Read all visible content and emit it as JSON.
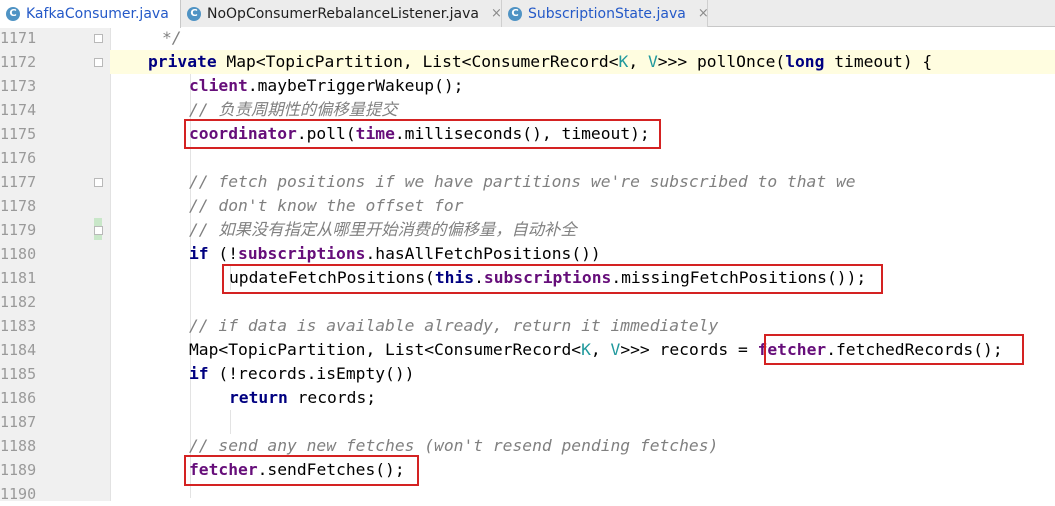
{
  "tabs": [
    {
      "label": "KafkaConsumer.java",
      "active": true
    },
    {
      "label": "NoOpConsumerRebalanceListener.java",
      "active": false
    },
    {
      "label": "SubscriptionState.java",
      "active": false
    }
  ],
  "tab_close_glyph": "×",
  "file_icon_letter": "C",
  "line_numbers": [
    "1171",
    "1172",
    "1173",
    "1174",
    "1175",
    "1176",
    "1177",
    "1178",
    "1179",
    "1180",
    "1181",
    "1182",
    "1183",
    "1184",
    "1185",
    "1186",
    "1187",
    "1188",
    "1189",
    "1190"
  ],
  "code": {
    "l1171": "*/",
    "l1172": {
      "kw_private": "private",
      "p1": " Map<TopicPartition, List<ConsumerRecord<",
      "k": "K",
      "p2": ", ",
      "v": "V",
      "p3": ">>> pollOnce(",
      "kw_long": "long",
      "p4": " timeout) {"
    },
    "l1173": {
      "fld": "client",
      "rest": ".maybeTriggerWakeup();"
    },
    "l1174": "// 负责周期性的偏移量提交",
    "l1175": {
      "fld1": "coordinator",
      "p1": ".poll(",
      "fld2": "time",
      "p2": ".milliseconds(), timeout);"
    },
    "l1177": "// fetch positions if we have partitions we're subscribed to that we",
    "l1178": "// don't know the offset for",
    "l1179": "// 如果没有指定从哪里开始消费的偏移量，自动补全",
    "l1180": {
      "kw_if": "if",
      "p1": " (!",
      "fld": "subscriptions",
      "p2": ".hasAllFetchPositions())"
    },
    "l1181": {
      "p1": "updateFetchPositions(",
      "kw_this": "this",
      "dot": ".",
      "fld": "subscriptions",
      "p2": ".missingFetchPositions());"
    },
    "l1183": "// if data is available already, return it immediately",
    "l1184": {
      "p1": "Map<TopicPartition, List<ConsumerRecord<",
      "k": "K",
      "p2": ", ",
      "v": "V",
      "p3": ">>> records = ",
      "fld": "fetcher",
      "p4": ".fetchedRecords();"
    },
    "l1185": {
      "kw_if": "if",
      "p1": " (!records.isEmpty())"
    },
    "l1186": {
      "kw_return": "return",
      "p1": " records;"
    },
    "l1188": "// send any new fetches (won't resend pending fetches)",
    "l1189": {
      "fld": "fetcher",
      "p1": ".sendFetches();"
    }
  },
  "colors": {
    "keyword": "#000080",
    "field": "#660e7a",
    "comment": "#808080",
    "type_param": "#20999d",
    "highlight_box": "#d42222",
    "current_line": "#fffde0"
  }
}
